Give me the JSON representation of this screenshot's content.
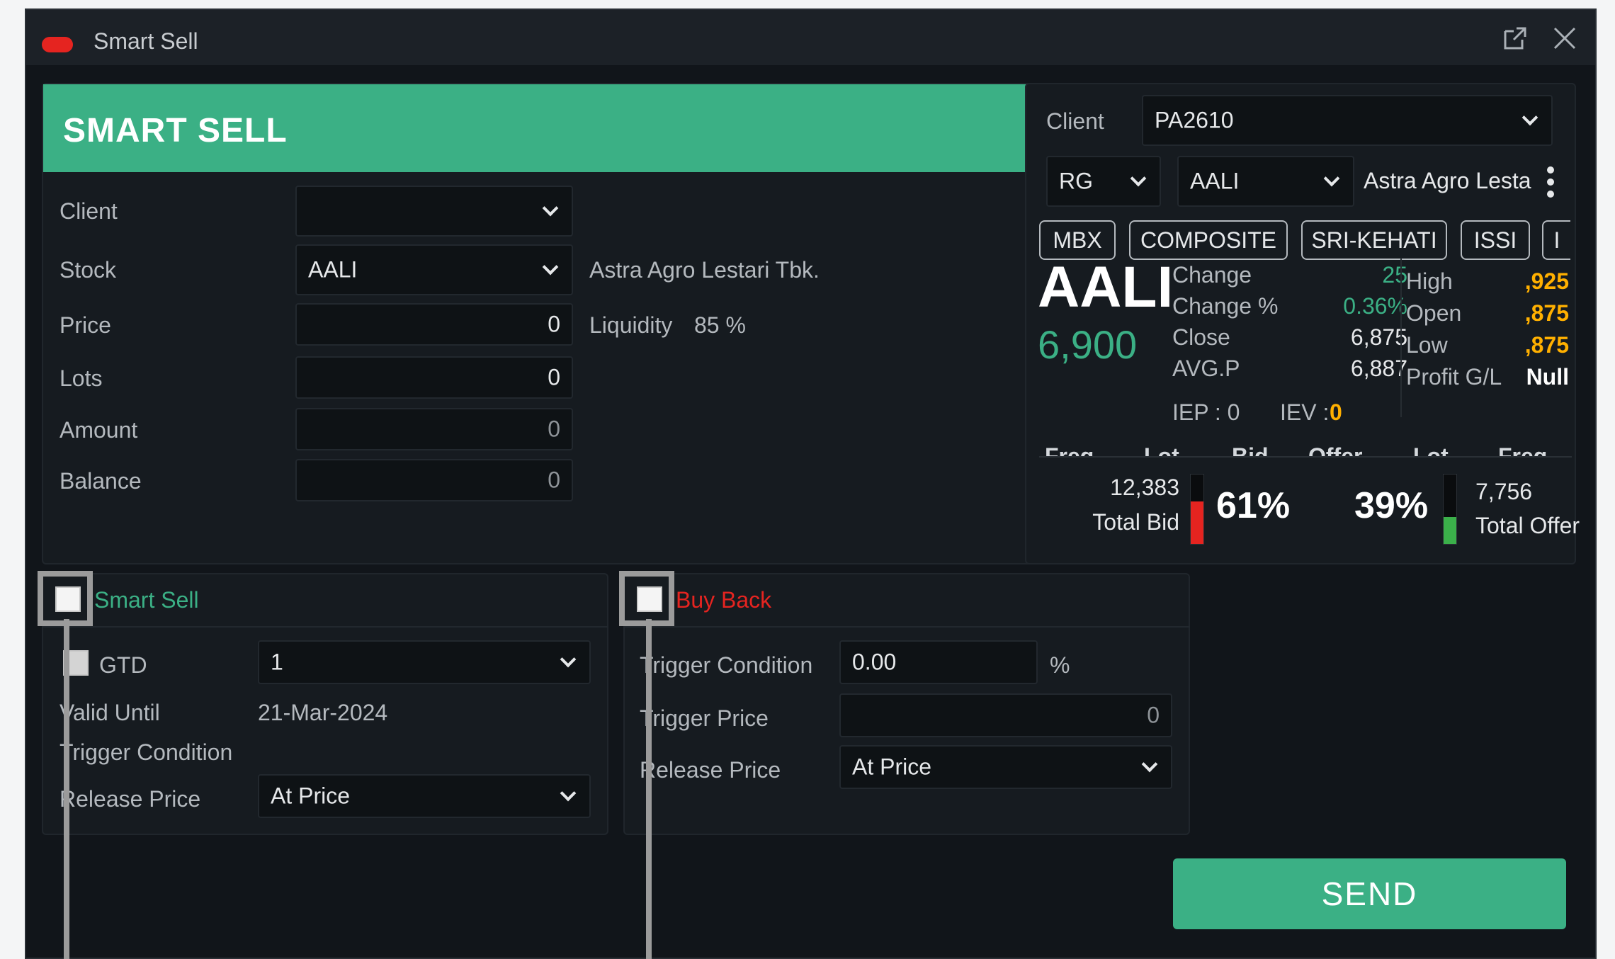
{
  "window": {
    "title": "Smart Sell",
    "popout_icon": "popout-icon",
    "close_icon": "close-icon"
  },
  "order": {
    "header": "SMART SELL",
    "client_label": "Client",
    "client_value": "",
    "stock_label": "Stock",
    "stock_value": "AALI",
    "stock_name": "Astra Agro Lestari Tbk.",
    "price_label": "Price",
    "price_value": "0",
    "liquidity_label": "Liquidity",
    "liquidity_value": "85 %",
    "lots_label": "Lots",
    "lots_value": "0",
    "amount_label": "Amount",
    "amount_value": "0",
    "balance_label": "Balance",
    "balance_value": "0"
  },
  "quote": {
    "client_label": "Client",
    "client_value": "PA2610",
    "board": "RG",
    "stock": "AALI",
    "stock_name": "Astra Agro Lesta",
    "tags": [
      "MBX",
      "COMPOSITE",
      "SRI-KEHATI",
      "ISSI",
      "I"
    ],
    "symbol": "AALI",
    "last_price": "6,900",
    "change_label": "Change",
    "change_value": "25",
    "change_pct_label": "Change %",
    "change_pct_value": "0.36%",
    "close_label": "Close",
    "close_value": "6,875",
    "avgp_label": "AVG.P",
    "avgp_value": "6,887",
    "high_label": "High",
    "high_value": ",925",
    "open_label": "Open",
    "open_value": ",875",
    "low_label": "Low",
    "low_value": ",875",
    "profit_label": "Profit G/L",
    "profit_value": "Null",
    "iep_label": "IEP : 0",
    "iev_label": "IEV :",
    "iev_value": "0",
    "depth_headers": [
      "Freq",
      "Lot",
      "Bid",
      "Offer",
      "Lot",
      "Freq"
    ],
    "total_bid_value": "12,383",
    "total_bid_label": "Total Bid",
    "bid_pct": "61%",
    "offer_pct": "39%",
    "total_offer_value": "7,756",
    "total_offer_label": "Total Offer",
    "bid_fill": 0.61,
    "offer_fill": 0.39
  },
  "smart_sell": {
    "title": "Smart Sell",
    "gtd_label": "GTD",
    "gtd_value": "1",
    "valid_until_label": "Valid Until",
    "valid_until_value": "21-Mar-2024",
    "trigger_condition_label": "Trigger Condition",
    "release_price_label": "Release Price",
    "release_price_value": "At Price"
  },
  "buy_back": {
    "title": "Buy Back",
    "trigger_condition_label": "Trigger Condition",
    "trigger_condition_value": "0.00",
    "trigger_condition_unit": "%",
    "trigger_price_label": "Trigger Price",
    "trigger_price_value": "0",
    "release_price_label": "Release Price",
    "release_price_value": "At Price"
  },
  "send_label": "SEND",
  "colors": {
    "accent_green": "#3bb085",
    "buy_back_red": "#e52420",
    "highlight_yellow": "#ffb000"
  }
}
